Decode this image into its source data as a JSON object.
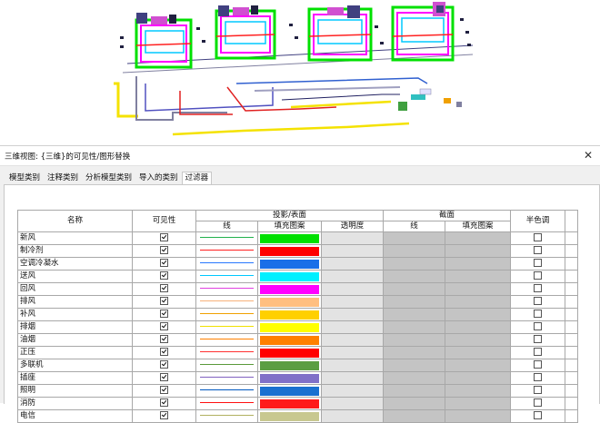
{
  "dialog": {
    "title": "三维视图: {三维}的可见性/图形替换",
    "close_glyph": "✕"
  },
  "tabs": [
    {
      "label": "模型类别",
      "active": false
    },
    {
      "label": "注释类别",
      "active": false
    },
    {
      "label": "分析模型类别",
      "active": false
    },
    {
      "label": "导入的类别",
      "active": false
    },
    {
      "label": "过滤器",
      "active": true
    }
  ],
  "table": {
    "headers": {
      "name": "名称",
      "visibility": "可见性",
      "projection": "投影/表面",
      "cut": "截面",
      "halftone": "半色调",
      "proj_line": "线",
      "proj_fill": "填充图案",
      "transparency": "透明度",
      "cut_line": "线",
      "cut_fill": "填充图案"
    },
    "rows": [
      {
        "name": "新风",
        "visible": true,
        "line_color": "#22b14c",
        "fill_color": "#00e000",
        "halftone": false
      },
      {
        "name": "制冷剂",
        "visible": true,
        "line_color": "#ff2020",
        "fill_color": "#ff0000",
        "halftone": false
      },
      {
        "name": "空调冷凝水",
        "visible": true,
        "line_color": "#2878ff",
        "fill_color": "#1a6fe8",
        "halftone": false
      },
      {
        "name": "送风",
        "visible": true,
        "line_color": "#00c8ff",
        "fill_color": "#00f0ff",
        "halftone": false
      },
      {
        "name": "回风",
        "visible": true,
        "line_color": "#e040e0",
        "fill_color": "#ff00ff",
        "halftone": false
      },
      {
        "name": "排风",
        "visible": true,
        "line_color": "#f7b27a",
        "fill_color": "#ffbf80",
        "halftone": false
      },
      {
        "name": "补风",
        "visible": true,
        "line_color": "#f0a000",
        "fill_color": "#ffd000",
        "halftone": false
      },
      {
        "name": "排烟",
        "visible": true,
        "line_color": "#f0e000",
        "fill_color": "#ffff00",
        "halftone": false
      },
      {
        "name": "油烟",
        "visible": true,
        "line_color": "#ff8000",
        "fill_color": "#ff8000",
        "halftone": false
      },
      {
        "name": "正压",
        "visible": true,
        "line_color": "#ff3030",
        "fill_color": "#ff0000",
        "halftone": false
      },
      {
        "name": "多联机",
        "visible": true,
        "line_color": "#5a9a3a",
        "fill_color": "#5b9e42",
        "halftone": false
      },
      {
        "name": "插座",
        "visible": true,
        "line_color": "#8060c0",
        "fill_color": "#8070c8",
        "halftone": false
      },
      {
        "name": "照明",
        "visible": true,
        "line_color": "#0058c0",
        "fill_color": "#1a70d0",
        "halftone": false
      },
      {
        "name": "消防",
        "visible": true,
        "line_color": "#ff1010",
        "fill_color": "#ff1a1a",
        "halftone": false
      },
      {
        "name": "电信",
        "visible": true,
        "line_color": "#b0b060",
        "fill_color": "#c8c890",
        "halftone": false
      }
    ]
  }
}
